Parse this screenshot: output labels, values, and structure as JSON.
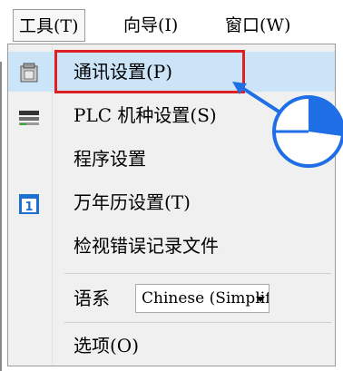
{
  "menubar": {
    "items": [
      {
        "label": "工具(T)",
        "name": "menu-tools"
      },
      {
        "label": "向导(I)",
        "name": "menu-wizard"
      },
      {
        "label": "窗口(W)",
        "name": "menu-window"
      }
    ]
  },
  "dropdown": {
    "items": [
      {
        "label": "通讯设置(P)",
        "icon": "plc-communication-icon"
      },
      {
        "label": "PLC 机种设置(S)",
        "icon": "plc-model-icon"
      },
      {
        "label": "程序设置",
        "icon": null,
        "submenu": true
      },
      {
        "label": "万年历设置(T)",
        "icon": "calendar-icon",
        "icon_text": "1"
      },
      {
        "label": "检视错误记录文件",
        "icon": null
      },
      {
        "label": "语系",
        "icon": null,
        "select_value": "Chinese (Simplifi"
      },
      {
        "label": "选项(O)",
        "icon": null
      }
    ]
  },
  "colors": {
    "highlight": "#cce4f7",
    "red_outline": "#e02020",
    "pointer_blue": "#1e6fe6"
  }
}
